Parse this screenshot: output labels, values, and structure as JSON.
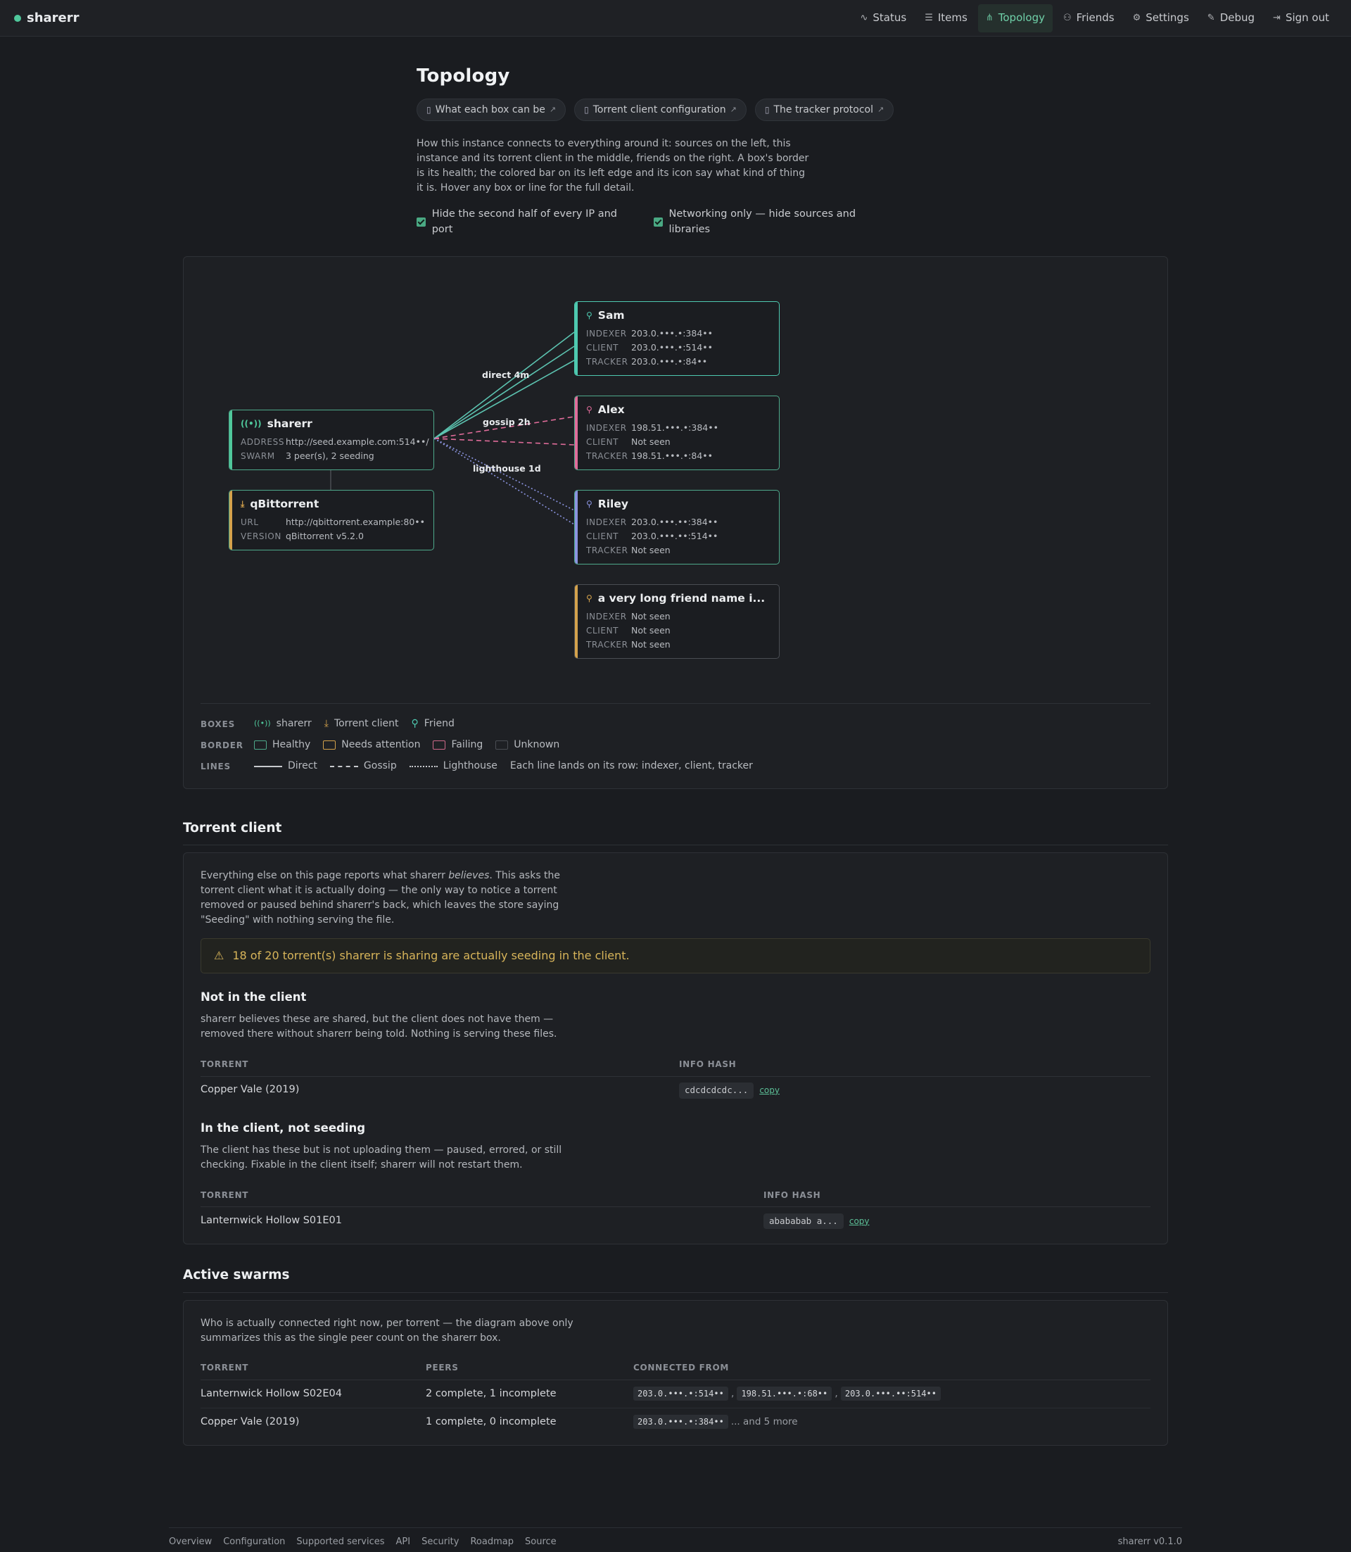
{
  "nav": {
    "brand": "sharerr",
    "links": [
      {
        "label": "Status",
        "icon": "activity-icon"
      },
      {
        "label": "Items",
        "icon": "list-icon"
      },
      {
        "label": "Topology",
        "icon": "topology-icon",
        "active": true
      },
      {
        "label": "Friends",
        "icon": "friends-icon"
      },
      {
        "label": "Settings",
        "icon": "sliders-icon"
      },
      {
        "label": "Debug",
        "icon": "wrench-icon"
      },
      {
        "label": "Sign out",
        "icon": "sign-out-icon"
      }
    ]
  },
  "page": {
    "title": "Topology",
    "doc_links": [
      "What each box can be",
      "Torrent client configuration",
      "The tracker protocol"
    ],
    "lead": "How this instance connects to everything around it: sources on the left, this instance and its torrent client in the middle, friends on the right. A box's border is its health; the colored bar on its left edge and its icon say what kind of thing it is. Hover any box or line for the full detail.",
    "checkbox_hide_ip": "Hide the second half of every IP and port",
    "checkbox_networking": "Networking only — hide sources and libraries"
  },
  "colors": {
    "accent": "#4fc79b",
    "healthy": "#4ea98b",
    "attention": "#d4a24c",
    "failing": "#d06a8a",
    "unknown": "#4a4d53",
    "friend_sam": "#4ec9b0",
    "friend_alex": "#e06c9a",
    "friend_riley": "#8b94e0",
    "friend_long": "#d4a24c",
    "warning": "#d8b55a"
  },
  "diagram": {
    "self": {
      "title": "sharerr",
      "icon": "antenna-icon",
      "rows": [
        {
          "k": "ADDRESS",
          "v": "http://seed.example.com:514••/"
        },
        {
          "k": "SWARM",
          "v": "3 peer(s), 2 seeding"
        }
      ]
    },
    "client": {
      "title": "qBittorrent",
      "icon": "download-icon",
      "rows": [
        {
          "k": "URL",
          "v": "http://qbittorrent.example:80••"
        },
        {
          "k": "VERSION",
          "v": "qBittorrent v5.2.0"
        }
      ]
    },
    "friends": [
      {
        "title": "Sam",
        "rows": [
          {
            "k": "INDEXER",
            "v": "203.0.•••.•:384••"
          },
          {
            "k": "CLIENT",
            "v": "203.0.•••.•:514••"
          },
          {
            "k": "TRACKER",
            "v": "203.0.•••.•:84••"
          }
        ]
      },
      {
        "title": "Alex",
        "rows": [
          {
            "k": "INDEXER",
            "v": "198.51.•••.•:384••"
          },
          {
            "k": "CLIENT",
            "v": "Not seen"
          },
          {
            "k": "TRACKER",
            "v": "198.51.•••.•:84••"
          }
        ]
      },
      {
        "title": "Riley",
        "rows": [
          {
            "k": "INDEXER",
            "v": "203.0.•••.••:384••"
          },
          {
            "k": "CLIENT",
            "v": "203.0.•••.••:514••"
          },
          {
            "k": "TRACKER",
            "v": "Not seen"
          }
        ]
      },
      {
        "title": "a very long friend name i...",
        "rows": [
          {
            "k": "INDEXER",
            "v": "Not seen"
          },
          {
            "k": "CLIENT",
            "v": "Not seen"
          },
          {
            "k": "TRACKER",
            "v": "Not seen"
          }
        ]
      }
    ],
    "edge_labels": [
      "direct 4m",
      "gossip 2h",
      "lighthouse 1d"
    ]
  },
  "legend": {
    "boxes_key": "BOXES",
    "boxes": [
      "sharerr",
      "Torrent client",
      "Friend"
    ],
    "border_key": "BORDER",
    "borders": [
      "Healthy",
      "Needs attention",
      "Failing",
      "Unknown"
    ],
    "lines_key": "LINES",
    "lines": [
      "Direct",
      "Gossip",
      "Lighthouse"
    ],
    "lines_note": "Each line lands on its row: indexer, client, tracker"
  },
  "torrent_client": {
    "heading": "Torrent client",
    "intro_pre": "Everything else on this page reports what sharerr ",
    "intro_em": "believes",
    "intro_post": ". This asks the torrent client what it is actually doing — the only way to notice a torrent removed or paused behind sharerr's back, which leaves the store saying \"Seeding\" with nothing serving the file.",
    "warning": "18 of 20 torrent(s) sharerr is sharing are actually seeding in the client.",
    "not_in_client": {
      "title": "Not in the client",
      "desc": "sharerr believes these are shared, but the client does not have them — removed there without sharerr being told. Nothing is serving these files.",
      "col_torrent": "TORRENT",
      "col_hash": "INFO HASH",
      "rows": [
        {
          "torrent": "Copper Vale (2019)",
          "hash": "cdcdcdcdc...",
          "copy": "copy"
        }
      ]
    },
    "not_seeding": {
      "title": "In the client, not seeding",
      "desc": "The client has these but is not uploading them — paused, errored, or still checking. Fixable in the client itself; sharerr will not restart them.",
      "col_torrent": "TORRENT",
      "col_hash": "INFO HASH",
      "rows": [
        {
          "torrent": "Lanternwick Hollow S01E01",
          "hash": "abababab a...",
          "copy": "copy"
        }
      ]
    }
  },
  "swarms": {
    "heading": "Active swarms",
    "desc": "Who is actually connected right now, per torrent — the diagram above only summarizes this as the single peer count on the sharerr box.",
    "col_torrent": "TORRENT",
    "col_peers": "PEERS",
    "col_from": "CONNECTED FROM",
    "rows": [
      {
        "torrent": "Lanternwick Hollow S02E04",
        "peers": "2 complete, 1 incomplete",
        "ips": [
          "203.0.•••.•:514••",
          "198.51.•••.•:68••",
          "203.0.•••.••:514••"
        ],
        "more": ""
      },
      {
        "torrent": "Copper Vale (2019)",
        "peers": "1 complete, 0 incomplete",
        "ips": [
          "203.0.•••.•:384••"
        ],
        "more": "... and 5 more"
      }
    ]
  },
  "footer": {
    "links": [
      "Overview",
      "Configuration",
      "Supported services",
      "API",
      "Security",
      "Roadmap",
      "Source"
    ],
    "version": "sharerr v0.1.0"
  }
}
